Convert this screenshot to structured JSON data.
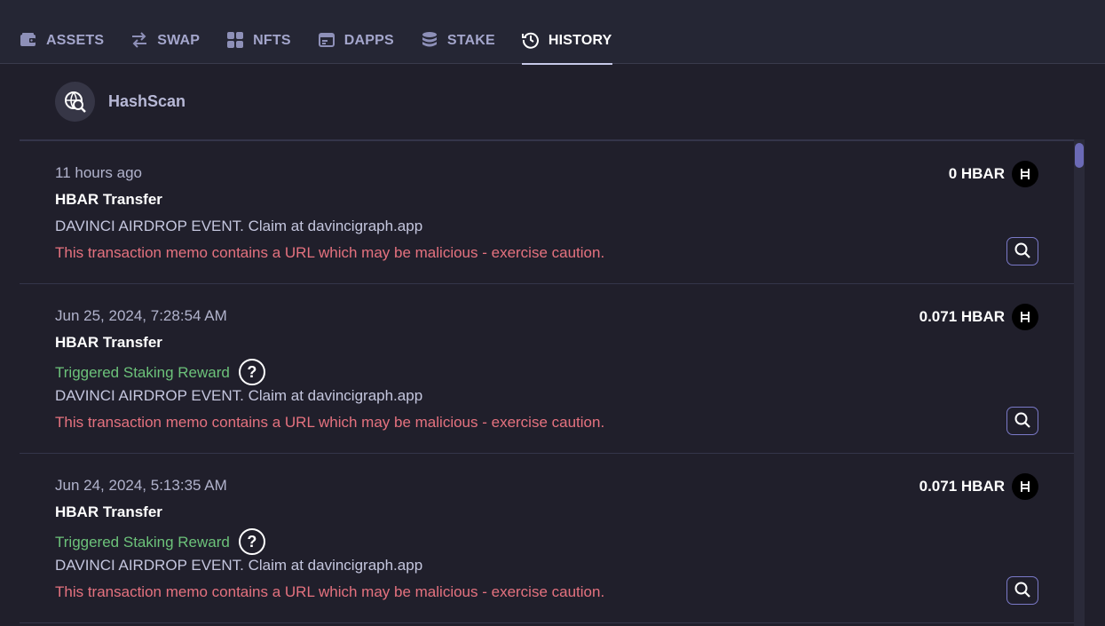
{
  "nav": {
    "tabs": [
      {
        "label": "ASSETS",
        "icon": "wallet-icon",
        "active": false
      },
      {
        "label": "SWAP",
        "icon": "swap-arrows-icon",
        "active": false
      },
      {
        "label": "NFTS",
        "icon": "grid-icon",
        "active": false
      },
      {
        "label": "DAPPS",
        "icon": "browser-window-icon",
        "active": false
      },
      {
        "label": "STAKE",
        "icon": "coin-stack-icon",
        "active": false
      },
      {
        "label": "HISTORY",
        "icon": "history-clock-icon",
        "active": true
      }
    ]
  },
  "hashscan": {
    "label": "HashScan",
    "icon": "globe-search-icon"
  },
  "transactions": [
    {
      "time": "11 hours ago",
      "title": "HBAR Transfer",
      "amount": "0 HBAR",
      "staking": null,
      "memo": "DAVINCI AIRDROP EVENT. Claim at davincigraph.app",
      "warning": "This transaction memo contains a URL which may be malicious - exercise caution."
    },
    {
      "time": "Jun 25, 2024, 7:28:54 AM",
      "title": "HBAR Transfer",
      "amount": "0.071 HBAR",
      "staking": "Triggered Staking Reward",
      "memo": "DAVINCI AIRDROP EVENT. Claim at davincigraph.app",
      "warning": "This transaction memo contains a URL which may be malicious - exercise caution."
    },
    {
      "time": "Jun 24, 2024, 5:13:35 AM",
      "title": "HBAR Transfer",
      "amount": "0.071 HBAR",
      "staking": "Triggered Staking Reward",
      "memo": "DAVINCI AIRDROP EVENT. Claim at davincigraph.app",
      "warning": "This transaction memo contains a URL which may be malicious - exercise caution."
    }
  ],
  "help_glyph": "?",
  "colors": {
    "background": "#201f2b",
    "nav_background": "#252634",
    "staking_green": "#6cc27a",
    "warning_red": "#e5727f",
    "accent_purple": "#7a79c8"
  }
}
